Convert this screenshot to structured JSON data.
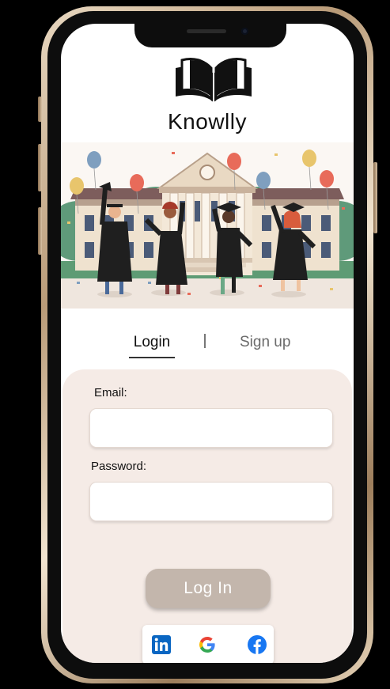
{
  "app": {
    "title": "Knowlly"
  },
  "tabs": {
    "login_label": "Login",
    "signup_label": "Sign up"
  },
  "form": {
    "email_label": "Email:",
    "email_value": "",
    "password_label": "Password:",
    "password_value": "",
    "login_button_label": "Log In"
  },
  "social": {
    "linkedin_label": "in"
  },
  "colors": {
    "panel": "#f5ebe6",
    "button": "#c3b6ac",
    "linkedin": "#0a66c2",
    "facebook": "#1877f2"
  },
  "icons": [
    "open-book-icon",
    "linkedin-icon",
    "google-icon",
    "facebook-icon"
  ]
}
